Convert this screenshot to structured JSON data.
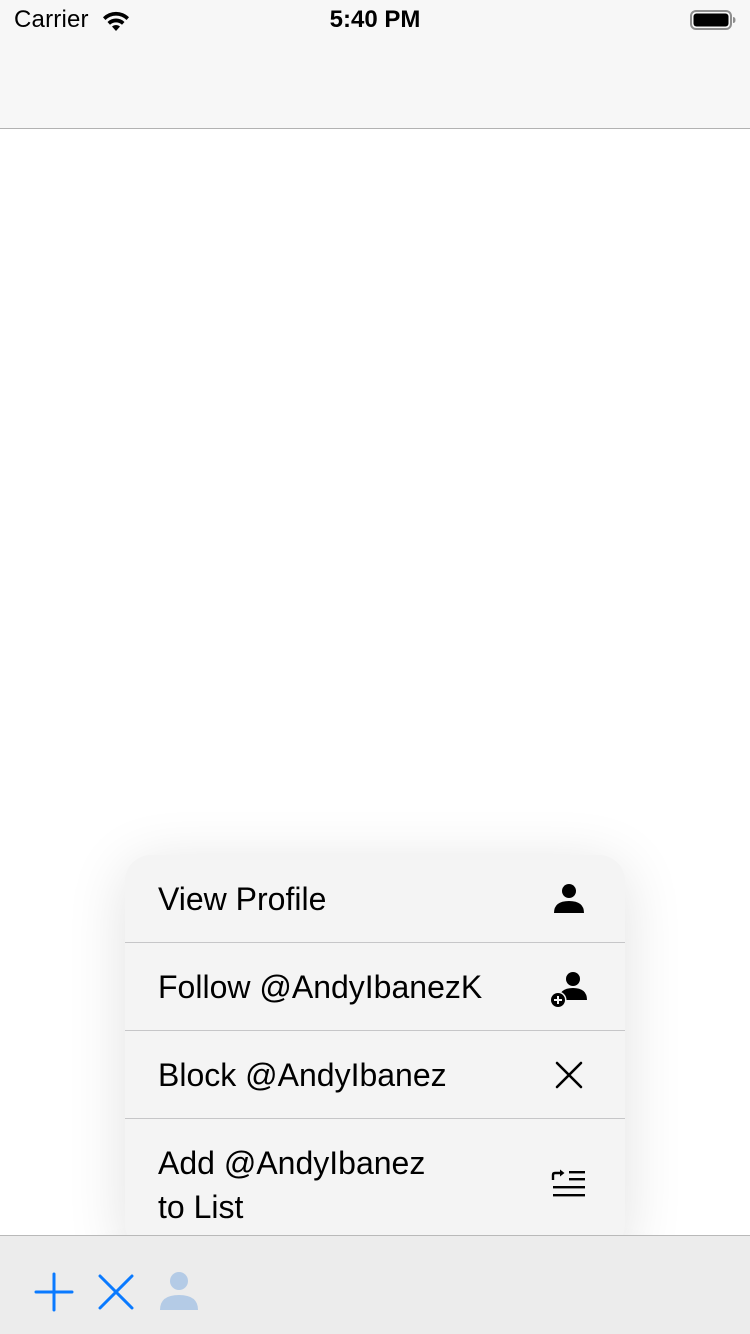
{
  "status_bar": {
    "carrier": "Carrier",
    "time": "5:40 PM",
    "wifi_icon": "wifi-icon",
    "battery_icon": "battery-icon"
  },
  "context_menu": {
    "items": [
      {
        "label": "View Profile",
        "icon": "person-icon"
      },
      {
        "label": "Follow @AndyIbanezK",
        "icon": "person-add-icon"
      },
      {
        "label": "Block @AndyIbanez",
        "icon": "xmark-icon"
      },
      {
        "label_line1": "Add @AndyIbanez",
        "label_line2": "to List",
        "icon": "list-add-icon"
      }
    ]
  },
  "toolbar": {
    "items": [
      {
        "icon": "plus-icon"
      },
      {
        "icon": "xmark-icon"
      },
      {
        "icon": "person-icon"
      }
    ],
    "accent_color": "#0a7aff",
    "disabled_color": "#b4cbe6"
  },
  "colors": {
    "bar_background": "#f7f7f7",
    "menu_background": "#f4f4f4",
    "separator": "#c6c6c8"
  }
}
